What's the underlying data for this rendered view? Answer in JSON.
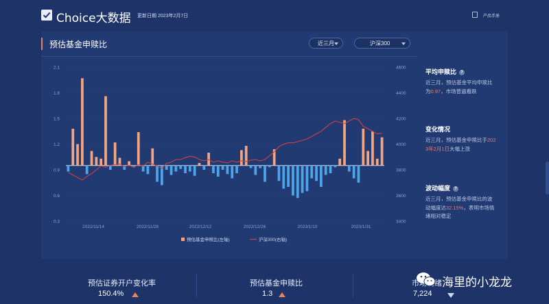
{
  "app": {
    "title": "Choice大数据",
    "update_date": "更新日期 2023年2月7日",
    "manual_label": "产品手册"
  },
  "panel": {
    "title": "预估基金申赎比",
    "period_select": "近三月",
    "index_select": "沪深300"
  },
  "chart_data": {
    "type": "bar",
    "title": "",
    "x_tick_labels": [
      "2022/11/14",
      "2022/11/28",
      "2022/12/12",
      "2022/12/26",
      "2023/1/10",
      "2023/1/31"
    ],
    "y_left": {
      "ticks": [
        "2.1",
        "1.8",
        "1.5",
        "1.2",
        "0.9",
        "0.6",
        "0.3"
      ],
      "range": [
        0.3,
        2.1
      ],
      "baseline": 0.95
    },
    "y_right": {
      "ticks": [
        "4600",
        "4400",
        "4200",
        "4000",
        "3800",
        "3600",
        "3400"
      ],
      "range": [
        3400,
        4600
      ]
    },
    "grid": true,
    "legend_position": "bottom-center",
    "series": [
      {
        "name": "预估基金申赎比(左轴)",
        "type": "bar",
        "axis": "left",
        "color_up": "#f3a583",
        "color_down": "#4fa3e8",
        "values": [
          0.88,
          1.38,
          1.2,
          1.97,
          0.85,
          1.12,
          1.05,
          1.03,
          1.76,
          0.9,
          1.22,
          1.04,
          0.9,
          1.0,
          0.93,
          1.34,
          0.88,
          0.85,
          1.15,
          0.76,
          0.72,
          0.9,
          0.84,
          0.88,
          0.91,
          0.86,
          0.88,
          0.83,
          0.98,
          0.9,
          1.1,
          0.86,
          0.82,
          0.9,
          0.85,
          0.8,
          0.86,
          1.13,
          1.18,
          0.92,
          0.84,
          0.92,
          0.76,
          0.93,
          1.14,
          0.77,
          0.68,
          0.7,
          0.6,
          0.57,
          0.63,
          0.65,
          0.8,
          0.77,
          0.7,
          0.84,
          0.86,
          0.93,
          1.03,
          1.48,
          0.88,
          0.8,
          0.75,
          1.38,
          1.12,
          1.35,
          1.03,
          1.28
        ]
      },
      {
        "name": "沪深300(右轴)",
        "type": "line",
        "axis": "right",
        "color": "#d2413e",
        "values": [
          3780,
          3760,
          3740,
          3720,
          3750,
          3770,
          3800,
          3830,
          3820,
          3835,
          3840,
          3845,
          3825,
          3835,
          3820,
          3840,
          3830,
          3860,
          3845,
          3830,
          3810,
          3850,
          3860,
          3880,
          3880,
          3895,
          3905,
          3900,
          3880,
          3870,
          3880,
          3860,
          3870,
          3860,
          3855,
          3870,
          3860,
          3870,
          3865,
          3875,
          3880,
          3870,
          3880,
          3910,
          3940,
          3980,
          4000,
          4010,
          4010,
          4020,
          4030,
          4040,
          4060,
          4080,
          4100,
          4130,
          4160,
          4180,
          4170,
          4160,
          4180,
          4200,
          4190,
          4140,
          4120,
          4100,
          4080,
          4085
        ]
      }
    ]
  },
  "side": {
    "avg": {
      "title": "平均申赎比",
      "text1": "近三月，预估基金平均申赎比",
      "text2_pre": "为",
      "text2_hl": "0.97",
      "text2_post": "，市场普遍看跌"
    },
    "change": {
      "title": "变化情况",
      "text1_pre": "近三月，预估基金申赎比于",
      "text1_hl": "202",
      "text2_hl": "3年2月1日",
      "text2_post": "大幅上涨"
    },
    "vol": {
      "title": "波动幅度",
      "text1": "近三月，预估基金申赎比的波",
      "text2_pre": "动幅度达",
      "text2_hl": "32.15%",
      "text2_post": "，表明市场情",
      "text3": "绪相对稳定"
    }
  },
  "stats": [
    {
      "label": "预估证券开户变化率",
      "value": "150.4%"
    },
    {
      "label": "预估基金申赎比",
      "value": "1.3"
    },
    {
      "label": "市场情绪",
      "value": "7,224"
    }
  ],
  "watermark": {
    "text": "海里的小龙龙"
  },
  "colors": {
    "background": "#1e3468",
    "panel": "#213a72",
    "accent": "#e8825b",
    "bar_up": "#f3a583",
    "bar_down": "#4fa3e8",
    "line": "#d2413e"
  }
}
